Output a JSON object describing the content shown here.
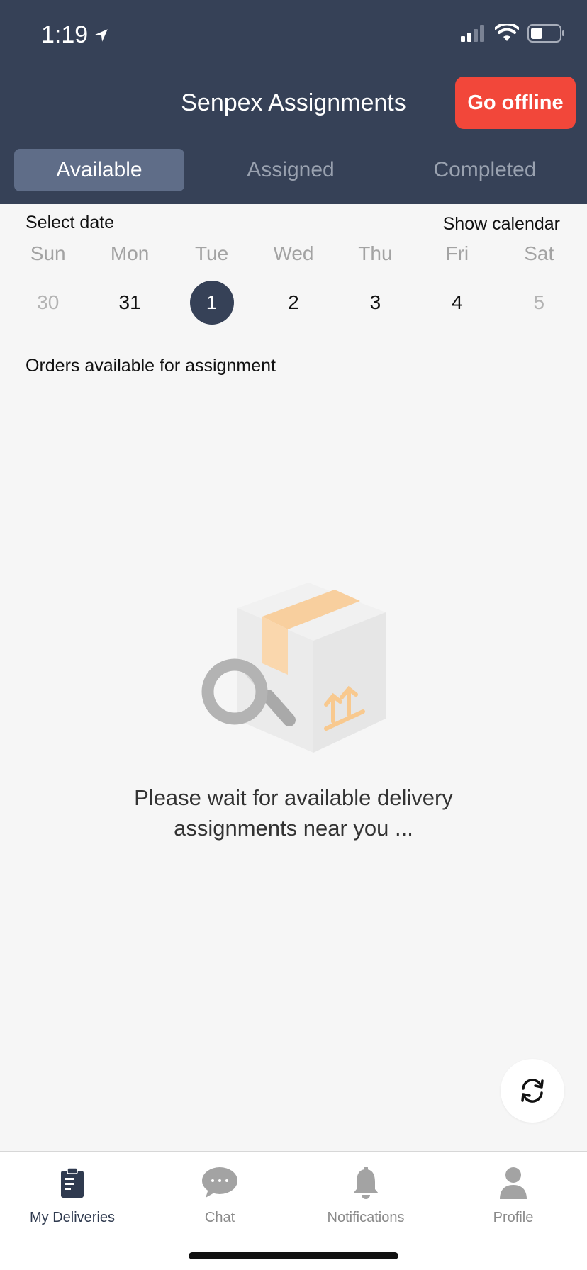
{
  "status_bar": {
    "time": "1:19"
  },
  "header": {
    "title": "Senpex Assignments",
    "offline_label": "Go offline",
    "tabs": [
      {
        "label": "Available",
        "active": true
      },
      {
        "label": "Assigned",
        "active": false
      },
      {
        "label": "Completed",
        "active": false
      }
    ]
  },
  "date_picker": {
    "select_label": "Select date",
    "calendar_label": "Show calendar",
    "weekdays": [
      "Sun",
      "Mon",
      "Tue",
      "Wed",
      "Thu",
      "Fri",
      "Sat"
    ],
    "dates": [
      "30",
      "31",
      "1",
      "2",
      "3",
      "4",
      "5"
    ],
    "selected_index": 2
  },
  "orders": {
    "label": "Orders available for assignment",
    "empty_line1": "Please wait for available delivery",
    "empty_line2": "assignments near you ..."
  },
  "nav": {
    "items": [
      {
        "label": "My Deliveries",
        "icon": "clipboard-icon",
        "active": true
      },
      {
        "label": "Chat",
        "icon": "chat-icon",
        "active": false
      },
      {
        "label": "Notifications",
        "icon": "bell-icon",
        "active": false
      },
      {
        "label": "Profile",
        "icon": "person-icon",
        "active": false
      }
    ]
  },
  "colors": {
    "header_bg": "#364157",
    "offline_button": "#f2473a",
    "active_tab": "#5f6d88",
    "selected_date": "#364157"
  }
}
